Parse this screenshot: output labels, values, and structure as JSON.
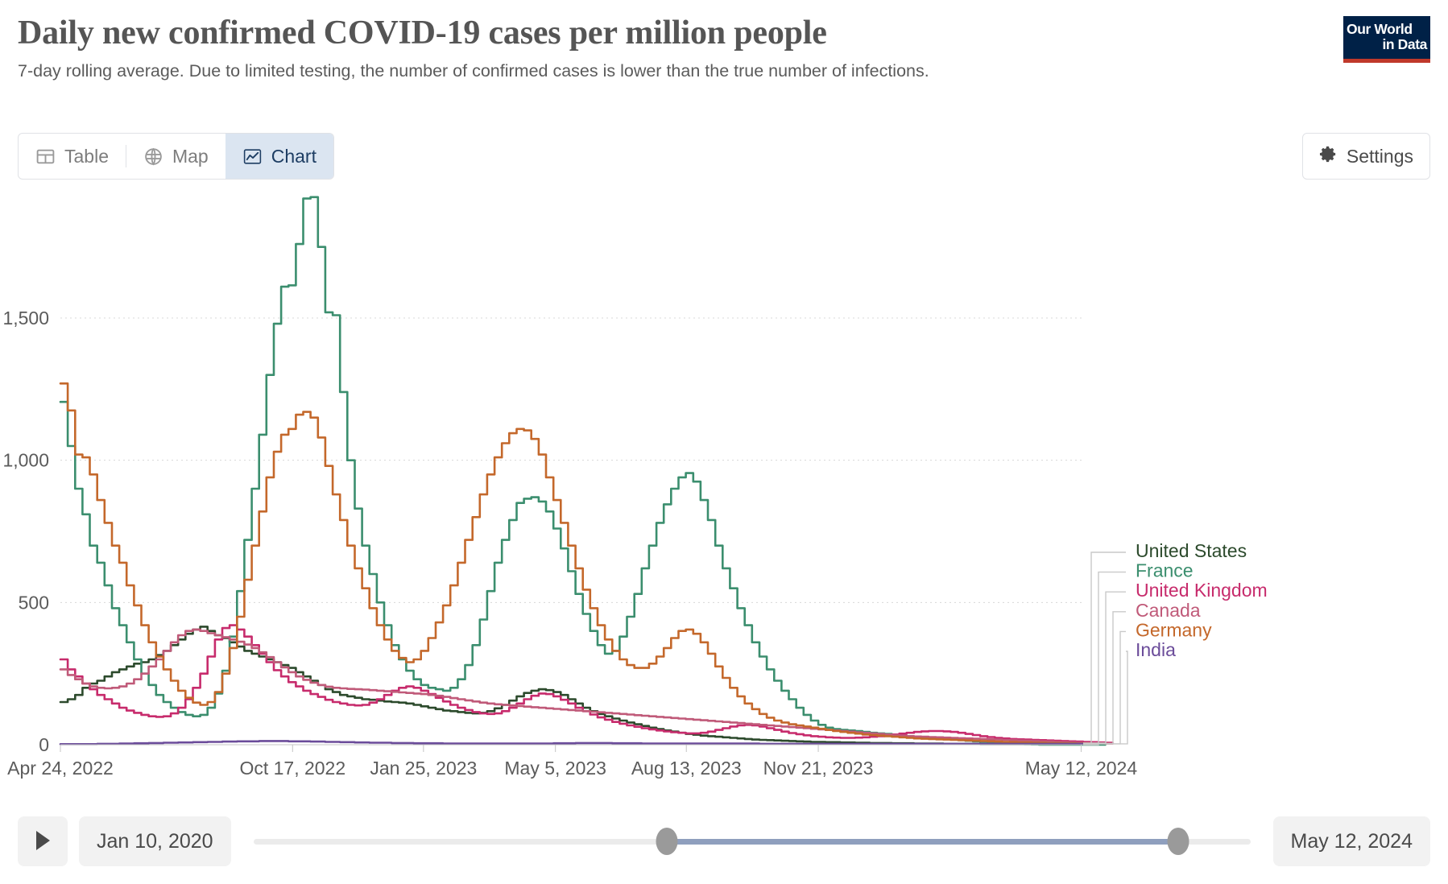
{
  "header": {
    "title": "Daily new confirmed COVID-19 cases per million people",
    "subtitle": "7-day rolling average. Due to limited testing, the number of confirmed cases is lower than the true number of infections.",
    "logo_line1": "Our World",
    "logo_line2": "in Data"
  },
  "tabs": [
    {
      "label": "Table",
      "icon": "table-icon",
      "active": false
    },
    {
      "label": "Map",
      "icon": "globe-icon",
      "active": false
    },
    {
      "label": "Chart",
      "icon": "line-chart-icon",
      "active": true
    }
  ],
  "settings": {
    "label": "Settings",
    "icon": "gear-icon"
  },
  "timeline": {
    "play_icon": "play-icon",
    "start_date": "Jan 10, 2020",
    "end_date": "May 12, 2024",
    "handle_start_pct": 41.5,
    "handle_end_pct": 92.8
  },
  "colors": {
    "united_states": "#2c4a2c",
    "france": "#3b8e6e",
    "united_kingdom": "#c72b6c",
    "canada": "#c05a79",
    "germany": "#c4682b",
    "india": "#6b4c9a",
    "tab_active_bg": "#dbe5f1",
    "tab_active_text": "#1d3d63",
    "logo_bg": "#002147",
    "logo_accent": "#c0392b",
    "slider_selected": "#8f9fbe"
  },
  "chart_data": {
    "type": "line",
    "title": "Daily new confirmed COVID-19 cases per million people",
    "subtitle": "7-day rolling average. Due to limited testing, the number of confirmed cases is lower than the true number of infections.",
    "xlabel": "",
    "ylabel": "",
    "ylim": [
      0,
      1950
    ],
    "yticks": [
      0,
      500,
      1000,
      1500
    ],
    "ytick_labels": [
      "0",
      "500",
      "1,000",
      "1,500"
    ],
    "grid": "horizontal-dotted",
    "legend_position": "right-direct-labels",
    "x_start": "Apr 24, 2022",
    "x_end": "May 12, 2024",
    "xtick_labels": [
      "Apr 24, 2022",
      "Oct 17, 2022",
      "Jan 25, 2023",
      "May 5, 2023",
      "Aug 13, 2023",
      "Nov 21, 2023",
      "May 12, 2024"
    ],
    "xtick_positions": [
      0.0,
      0.227,
      0.355,
      0.484,
      0.612,
      0.741,
      0.998
    ],
    "series": [
      {
        "name": "United States",
        "color": "#2c4a2c",
        "values": [
          150,
          160,
          175,
          200,
          215,
          225,
          240,
          255,
          265,
          275,
          285,
          290,
          300,
          315,
          330,
          350,
          370,
          390,
          405,
          415,
          400,
          385,
          375,
          360,
          345,
          330,
          320,
          310,
          300,
          290,
          280,
          270,
          255,
          240,
          225,
          210,
          195,
          185,
          175,
          170,
          165,
          160,
          158,
          155,
          152,
          150,
          148,
          145,
          140,
          135,
          130,
          125,
          120,
          118,
          115,
          112,
          110,
          112,
          118,
          128,
          140,
          155,
          170,
          182,
          190,
          195,
          192,
          185,
          175,
          160,
          145,
          130,
          118,
          108,
          100,
          92,
          85,
          78,
          72,
          66,
          60,
          55,
          50,
          46,
          42,
          38,
          35,
          32,
          30,
          28,
          26,
          24,
          22,
          20,
          18,
          17,
          16,
          15,
          14,
          13,
          12,
          11,
          10,
          10,
          9,
          9,
          8,
          8,
          7,
          7,
          6,
          6,
          6,
          5,
          5,
          5,
          4,
          4,
          4,
          4,
          3,
          3,
          3,
          3,
          3,
          2,
          2,
          2,
          2,
          2,
          2,
          2,
          2,
          2,
          2,
          2,
          2,
          2,
          2,
          2
        ]
      },
      {
        "name": "France",
        "color": "#3b8e6e",
        "values": [
          1205,
          1050,
          900,
          810,
          700,
          640,
          560,
          480,
          420,
          360,
          300,
          250,
          210,
          175,
          150,
          130,
          115,
          105,
          100,
          105,
          130,
          180,
          260,
          380,
          540,
          720,
          900,
          1090,
          1300,
          1480,
          1610,
          1615,
          1760,
          1920,
          1925,
          1750,
          1520,
          1510,
          1240,
          1000,
          830,
          700,
          600,
          500,
          420,
          350,
          300,
          260,
          230,
          210,
          200,
          195,
          190,
          200,
          230,
          280,
          350,
          440,
          540,
          640,
          720,
          790,
          850,
          865,
          870,
          855,
          820,
          760,
          690,
          610,
          530,
          460,
          400,
          350,
          320,
          330,
          380,
          450,
          530,
          620,
          700,
          780,
          845,
          900,
          940,
          955,
          925,
          860,
          790,
          700,
          620,
          550,
          480,
          420,
          360,
          310,
          265,
          225,
          190,
          160,
          130,
          105,
          85,
          70,
          60,
          55,
          52,
          50,
          48,
          45,
          42,
          40,
          38,
          35,
          32,
          30,
          28,
          26,
          24,
          22,
          20,
          18,
          16,
          14,
          12,
          10,
          8,
          6,
          5,
          4,
          3,
          2,
          1,
          0,
          0,
          0,
          0,
          0,
          0,
          0,
          0,
          0,
          0
        ]
      },
      {
        "name": "United Kingdom",
        "color": "#c72b6c",
        "values": [
          300,
          265,
          240,
          215,
          195,
          175,
          160,
          145,
          130,
          120,
          112,
          105,
          100,
          98,
          100,
          110,
          130,
          160,
          200,
          250,
          310,
          370,
          410,
          420,
          405,
          380,
          350,
          320,
          290,
          262,
          240,
          220,
          205,
          190,
          178,
          168,
          158,
          150,
          145,
          140,
          138,
          140,
          148,
          160,
          175,
          190,
          200,
          205,
          200,
          190,
          178,
          165,
          152,
          140,
          130,
          122,
          115,
          110,
          108,
          110,
          118,
          130,
          145,
          160,
          172,
          180,
          178,
          170,
          158,
          145,
          130,
          118,
          106,
          96,
          88,
          80,
          74,
          68,
          63,
          58,
          54,
          50,
          47,
          44,
          42,
          40,
          40,
          42,
          46,
          52,
          58,
          64,
          68,
          70,
          68,
          64,
          58,
          52,
          46,
          41,
          37,
          33,
          30,
          28,
          26,
          25,
          24,
          24,
          25,
          26,
          28,
          30,
          33,
          36,
          39,
          42,
          45,
          47,
          48,
          48,
          47,
          45,
          42,
          38,
          34,
          30,
          27,
          24,
          22,
          20,
          19,
          18,
          17,
          16,
          15,
          14,
          13,
          12,
          11,
          10,
          9,
          8,
          7,
          6
        ]
      },
      {
        "name": "Canada",
        "color": "#c05a79",
        "values": [
          265,
          245,
          230,
          215,
          205,
          200,
          198,
          200,
          205,
          215,
          230,
          250,
          275,
          300,
          330,
          360,
          385,
          400,
          405,
          400,
          392,
          385,
          378,
          370,
          362,
          352,
          340,
          325,
          308,
          290,
          272,
          255,
          240,
          228,
          218,
          210,
          204,
          200,
          198,
          196,
          195,
          194,
          192,
          190,
          188,
          186,
          184,
          182,
          180,
          178,
          175,
          172,
          168,
          164,
          160,
          156,
          152,
          148,
          145,
          142,
          140,
          138,
          136,
          134,
          132,
          130,
          128,
          126,
          124,
          122,
          120,
          118,
          116,
          114,
          112,
          110,
          108,
          106,
          104,
          102,
          100,
          98,
          96,
          94,
          92,
          90,
          88,
          86,
          84,
          82,
          80,
          78,
          76,
          74,
          72,
          70,
          68,
          66,
          64,
          62,
          60,
          58,
          56,
          54,
          52,
          50,
          48,
          46,
          44,
          42,
          40,
          38,
          36,
          34,
          32,
          30,
          29,
          28,
          27,
          26,
          25,
          24,
          23,
          22,
          21,
          20,
          19,
          18,
          17,
          16,
          15,
          14,
          13,
          12,
          11,
          10,
          9,
          8,
          7,
          6,
          5,
          5,
          4,
          4
        ]
      },
      {
        "name": "Germany",
        "color": "#c4682b",
        "values": [
          1270,
          1175,
          1020,
          1010,
          950,
          860,
          780,
          700,
          640,
          560,
          490,
          420,
          360,
          310,
          265,
          225,
          190,
          165,
          148,
          140,
          150,
          185,
          250,
          340,
          450,
          580,
          700,
          820,
          940,
          1030,
          1090,
          1110,
          1160,
          1170,
          1150,
          1080,
          980,
          880,
          790,
          700,
          620,
          550,
          480,
          420,
          370,
          330,
          305,
          290,
          300,
          330,
          375,
          430,
          490,
          560,
          640,
          720,
          800,
          880,
          950,
          1010,
          1060,
          1095,
          1110,
          1105,
          1075,
          1020,
          940,
          860,
          780,
          700,
          620,
          545,
          480,
          420,
          370,
          330,
          300,
          280,
          270,
          270,
          285,
          310,
          340,
          375,
          400,
          405,
          390,
          360,
          320,
          275,
          235,
          200,
          170,
          145,
          125,
          108,
          95,
          85,
          78,
          72,
          68,
          64,
          60,
          56,
          52,
          48,
          45,
          42,
          39,
          36,
          34,
          32,
          30,
          28,
          26,
          24,
          22,
          21,
          20,
          19,
          18,
          17,
          16,
          15,
          14,
          13,
          12,
          11,
          10,
          9,
          8,
          8,
          7,
          7,
          6,
          6,
          5,
          5,
          4,
          4,
          3,
          3
        ]
      },
      {
        "name": "India",
        "color": "#6b4c9a",
        "values": [
          2,
          2,
          2,
          2,
          2,
          3,
          3,
          3,
          4,
          4,
          5,
          5,
          6,
          6,
          7,
          7,
          8,
          8,
          9,
          9,
          10,
          10,
          11,
          11,
          12,
          12,
          12,
          13,
          13,
          13,
          13,
          12,
          12,
          12,
          11,
          11,
          10,
          10,
          9,
          9,
          8,
          8,
          7,
          7,
          7,
          6,
          6,
          6,
          5,
          5,
          5,
          5,
          4,
          4,
          4,
          4,
          4,
          4,
          4,
          4,
          4,
          4,
          4,
          4,
          4,
          4,
          4,
          5,
          5,
          5,
          6,
          6,
          6,
          6,
          6,
          5,
          5,
          5,
          5,
          4,
          4,
          4,
          4,
          4,
          4,
          4,
          4,
          4,
          4,
          4,
          4,
          4,
          4,
          4,
          4,
          3,
          3,
          3,
          3,
          3,
          3,
          3,
          3,
          3,
          3,
          3,
          3,
          3,
          3,
          3,
          3,
          3,
          3,
          3,
          3,
          3,
          3,
          3,
          3,
          3,
          3,
          3,
          3,
          3,
          3,
          3,
          3,
          3,
          3,
          3,
          3,
          3,
          3,
          3,
          3,
          3,
          3,
          3,
          3,
          3
        ]
      }
    ]
  }
}
